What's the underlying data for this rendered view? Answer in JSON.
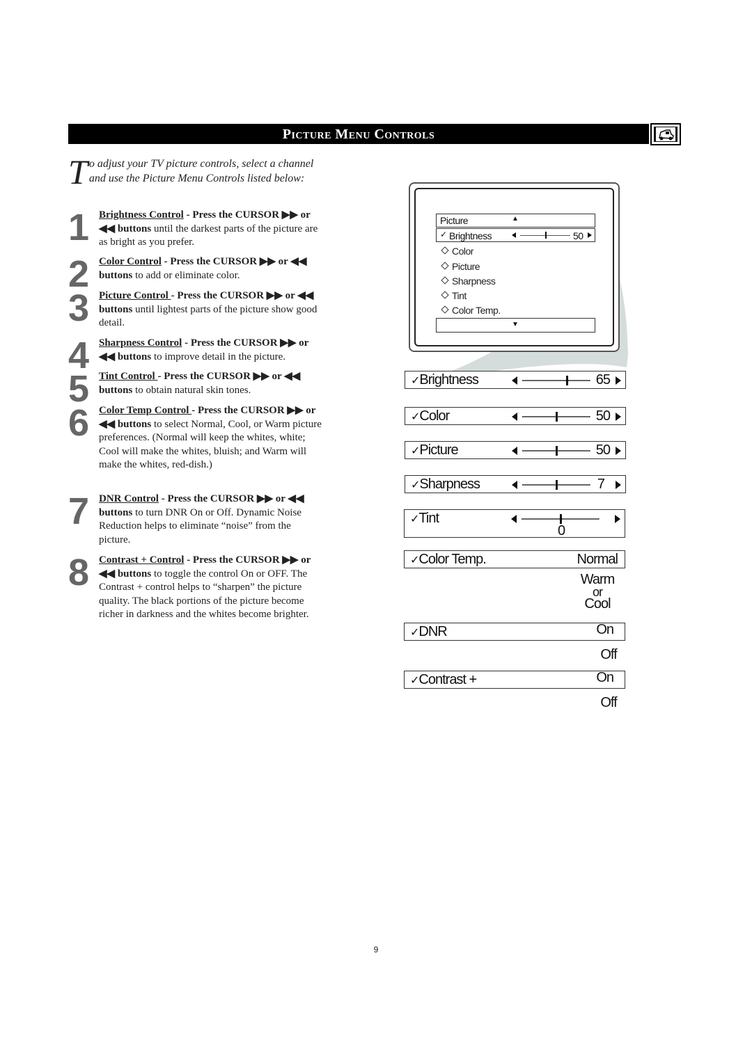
{
  "header": {
    "title": "Picture Menu Controls",
    "icon": "tv-car-icon"
  },
  "intro": {
    "drop_cap": "T",
    "text": "o adjust your TV picture controls, select a channel and use the Picture Menu Controls listed below:"
  },
  "steps": [
    {
      "num": "1",
      "title": "Brightness Control",
      "bold": " - Press the CURSOR ▶▶ or ◀◀  buttons",
      "text": " until the darkest parts of the picture are as bright as you prefer."
    },
    {
      "num": "2",
      "title": "Color Control",
      "bold": " - Press the CURSOR ▶▶ or ◀◀  buttons",
      "text": " to add or eliminate color."
    },
    {
      "num": "3",
      "title": "Picture Control ",
      "bold": "- Press the CURSOR ▶▶ or ◀◀  buttons",
      "text": " until lightest parts of the picture show good detail."
    },
    {
      "num": "4",
      "title": "Sharpness Control",
      "bold": " - Press the CURSOR ▶▶ or ◀◀  buttons",
      "text": " to improve detail in the picture."
    },
    {
      "num": "5",
      "title": "Tint Control ",
      "bold": "- Press the CURSOR ▶▶ or ◀◀ buttons",
      "text": " to obtain natural skin tones."
    },
    {
      "num": "6",
      "title": "Color Temp Control ",
      "bold": "- Press the CURSOR ▶▶ or ◀◀  buttons",
      "text": " to select Normal, Cool, or Warm picture preferences. (Normal will keep the whites, white; Cool will make the whites, bluish; and Warm will make the whites, red-dish.)"
    },
    {
      "num": "7",
      "title": "DNR Control",
      "bold": " - Press the CURSOR ▶▶ or ◀◀ buttons",
      "text": " to turn DNR On or Off.  Dynamic Noise Reduction helps to eliminate “noise” from the picture."
    },
    {
      "num": "8",
      "title": "Contrast + Control",
      "bold": " - Press the CURSOR ▶▶ or ◀◀  buttons",
      "text": " to toggle the control On or OFF. The Contrast + control helps to “sharpen” the picture quality. The black portions of the picture become richer in darkness and the whites become brighter."
    }
  ],
  "tv_menu": {
    "header": "Picture",
    "up_arrow": "▲",
    "down_arrow": "▼",
    "selected": {
      "label": "Brightness",
      "value": "50",
      "level": 0.5
    },
    "items": [
      "Color",
      "Picture",
      "Sharpness",
      "Tint",
      "Color Temp."
    ]
  },
  "controls": {
    "brightness": {
      "label": "Brightness",
      "value": "65",
      "level": 0.65
    },
    "color": {
      "label": "Color",
      "value": "50",
      "level": 0.5
    },
    "picture": {
      "label": "Picture",
      "value": "50",
      "level": 0.5
    },
    "sharpness": {
      "label": "Sharpness",
      "value": "7",
      "level": 0.5
    },
    "tint": {
      "label": "Tint",
      "value": "0",
      "level": 0.5
    },
    "color_temp": {
      "label": "Color Temp.",
      "value": "Normal",
      "alt1": "Warm",
      "or": "or",
      "alt2": "Cool"
    },
    "dnr": {
      "label": "DNR",
      "value": "On",
      "alt": "Off"
    },
    "contrast": {
      "label": "Contrast +",
      "value": "On",
      "alt": "Off"
    }
  },
  "check": "✓",
  "page_number": "9"
}
